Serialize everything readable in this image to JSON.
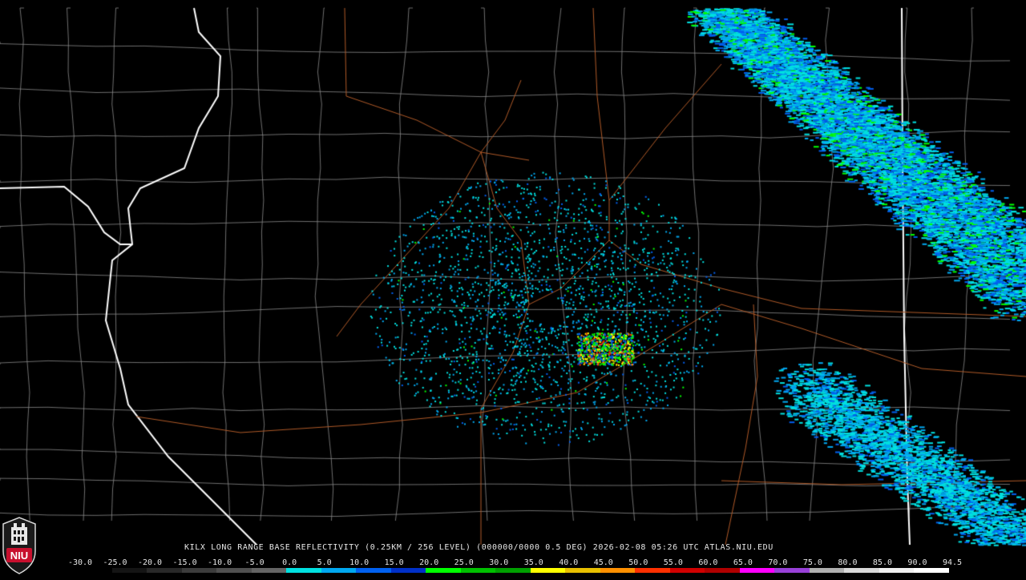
{
  "title": "KILX LONG RANGE BASE REFLECTIVITY (0.25KM / 256 LEVEL) (000000/0000 0.5 DEG) 2026-02-08 05:26 UTC  ATLAS.NIU.EDU",
  "logo": {
    "icon": "niu-logo-icon",
    "text": "NIU",
    "color": "#c8102e"
  },
  "colorbar": {
    "labels": [
      "-30.0",
      "-25.0",
      "-20.0",
      "-15.0",
      "-10.0",
      "-5.0",
      "0.0",
      "5.0",
      "10.0",
      "15.0",
      "20.0",
      "25.0",
      "30.0",
      "35.0",
      "40.0",
      "45.0",
      "50.0",
      "55.0",
      "60.0",
      "65.0",
      "70.0",
      "75.0",
      "80.0",
      "85.0",
      "90.0",
      "94.5"
    ],
    "colors": [
      "#000000",
      "#141414",
      "#282828",
      "#3c3c3c",
      "#505050",
      "#646464",
      "#00e0e0",
      "#00a8f0",
      "#0060f0",
      "#0030c8",
      "#00ff00",
      "#00c000",
      "#00a000",
      "#ffff00",
      "#e8c000",
      "#ff9000",
      "#ff3000",
      "#d00000",
      "#b00000",
      "#ff00ff",
      "#9840d8",
      "#b0b0b0",
      "#d8d8d8",
      "#f0f0f0",
      "#ffffff"
    ]
  },
  "map": {
    "background": "#000000",
    "county_line_color": "#8a8a8a",
    "state_line_color": "#ffffff",
    "highway_color": "#b05a28"
  }
}
